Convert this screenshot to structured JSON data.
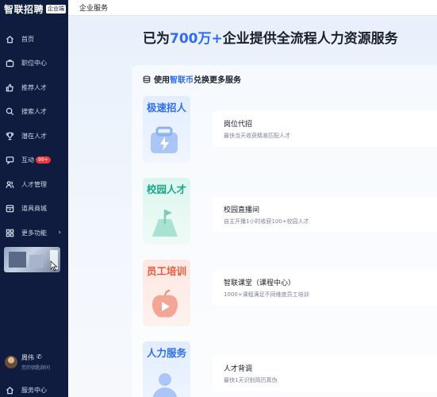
{
  "brand": {
    "name": "智联招聘",
    "badge": "企业端"
  },
  "topbar": {
    "title": "企业服务"
  },
  "nav": [
    {
      "label": "首页",
      "icon": "home-icon"
    },
    {
      "label": "职位中心",
      "icon": "briefcase-icon"
    },
    {
      "label": "推荐人才",
      "icon": "thumb-up-icon"
    },
    {
      "label": "搜索人才",
      "icon": "search-icon"
    },
    {
      "label": "潜在人才",
      "icon": "trophy-icon"
    },
    {
      "label": "互动",
      "icon": "chat-icon",
      "badge": "99+"
    },
    {
      "label": "人才管理",
      "icon": "people-icon"
    },
    {
      "label": "道具商城",
      "icon": "store-icon"
    },
    {
      "label": "更多功能",
      "icon": "grid-icon",
      "chevron": "›"
    }
  ],
  "user": {
    "name": "周伟",
    "phone_icon": "✆",
    "subtitle": "您的钥匙顾问"
  },
  "footer": {
    "service_center": "服务中心"
  },
  "hero": {
    "prefix": "已为",
    "number": "700万+",
    "suffix": "企业提供全流程人力资源服务"
  },
  "panel": {
    "prefix": "使用",
    "coin": "智联币",
    "suffix": "兑换更多服务"
  },
  "services": [
    {
      "title": "极速招人",
      "color": "#2f6cf0",
      "feature": "岗位代招",
      "desc": "最快当天收获精准匹配人才"
    },
    {
      "title": "校园人才",
      "color": "#17a78a",
      "feature": "校园直播间",
      "desc": "自主开播1小时收获100+校园人才"
    },
    {
      "title": "员工培训",
      "color": "#e8593f",
      "feature": "智联课堂（课程中心）",
      "desc": "1000+课程满足不同维度员工培训"
    },
    {
      "title": "人力服务",
      "color": "#2f6cf0",
      "feature": "人才背调",
      "desc": "最快1天识别简历真伪"
    }
  ]
}
